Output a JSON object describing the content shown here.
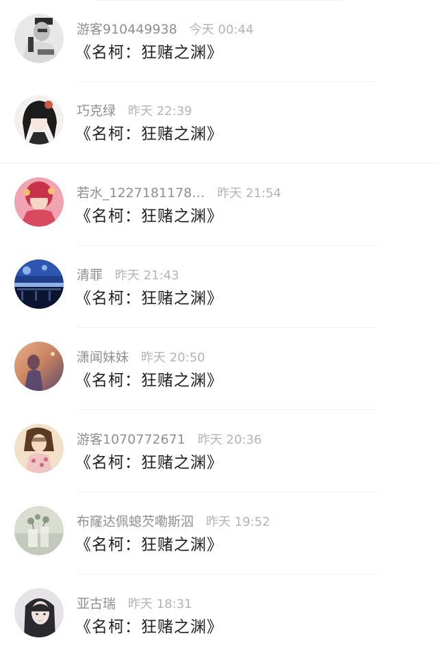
{
  "comments": [
    {
      "username": "游客910449938",
      "time": "今天 00:44",
      "text": "《名柯：狂赌之渊》",
      "avatar_colors": [
        "#e8e8e8",
        "#3a3a3a",
        "#bdbdbd"
      ]
    },
    {
      "username": "巧克绿",
      "time": "昨天 22:39",
      "text": "《名柯：狂赌之渊》",
      "avatar_colors": [
        "#f4f0ee",
        "#1c1c1c",
        "#c95a4a"
      ]
    },
    {
      "username": "若水_1227181178…",
      "time": "昨天 21:54",
      "text": "《名柯：狂赌之渊》",
      "avatar_colors": [
        "#f0a3b0",
        "#c8324a",
        "#f7d6c8"
      ]
    },
    {
      "username": "清罪",
      "time": "昨天 21:43",
      "text": "《名柯：狂赌之渊》",
      "avatar_colors": [
        "#1f3f8a",
        "#0b1430",
        "#8fb0e8"
      ]
    },
    {
      "username": "潇闻妹妹",
      "time": "昨天 20:50",
      "text": "《名柯：狂赌之渊》",
      "avatar_colors": [
        "#c7825e",
        "#5c4a6e",
        "#e9b08a"
      ]
    },
    {
      "username": "游客1070772671",
      "time": "昨天 20:36",
      "text": "《名柯：狂赌之渊》",
      "avatar_colors": [
        "#f3e0c8",
        "#5a3a22",
        "#d06a7a"
      ]
    },
    {
      "username": "布窿达佩螅芡嘞斯泅",
      "time": "昨天 19:52",
      "text": "《名柯：狂赌之渊》",
      "avatar_colors": [
        "#d9ddd2",
        "#8d9a86",
        "#f4f4ee"
      ]
    },
    {
      "username": "亚古瑞",
      "time": "昨天 18:31",
      "text": "《名柯：狂赌之渊》",
      "avatar_colors": [
        "#e6e3e6",
        "#2a2a2e",
        "#c9b9b6"
      ]
    }
  ]
}
